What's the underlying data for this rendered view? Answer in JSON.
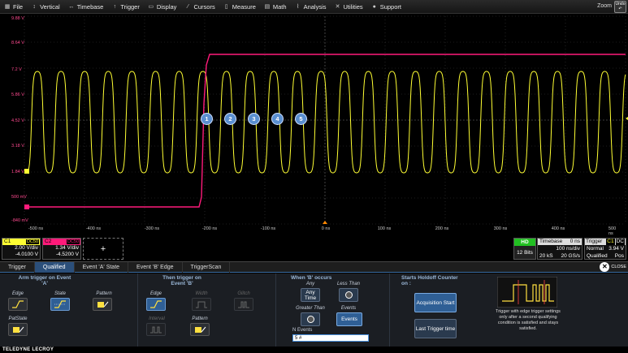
{
  "menubar": {
    "items": [
      {
        "label": "File",
        "icon": "file-icon"
      },
      {
        "label": "Vertical",
        "icon": "vertical-icon"
      },
      {
        "label": "Timebase",
        "icon": "timebase-icon"
      },
      {
        "label": "Trigger",
        "icon": "trigger-icon"
      },
      {
        "label": "Display",
        "icon": "display-icon"
      },
      {
        "label": "Cursors",
        "icon": "cursors-icon"
      },
      {
        "label": "Measure",
        "icon": "measure-icon"
      },
      {
        "label": "Math",
        "icon": "math-icon"
      },
      {
        "label": "Analysis",
        "icon": "analysis-icon"
      },
      {
        "label": "Utilities",
        "icon": "utilities-icon"
      },
      {
        "label": "Support",
        "icon": "support-icon"
      }
    ],
    "zoom_label": "Zoom",
    "undo_label": "Undo"
  },
  "grid": {
    "y_labels": [
      "9.88 V",
      "8.64 V",
      "7.2 V",
      "5.86 V",
      "4.52 V",
      "3.18 V",
      "1.84 V",
      "500 mV",
      "-840 mV"
    ],
    "x_labels": [
      "-500 ns",
      "-400 ns",
      "-300 ns",
      "-200 ns",
      "-100 ns",
      "0 ns",
      "100 ns",
      "200 ns",
      "300 ns",
      "400 ns",
      "500 ns"
    ],
    "markers": [
      "1",
      "2",
      "3",
      "4",
      "5"
    ],
    "ch1_color": "#ffff33",
    "ch2_color": "#ff1a7a"
  },
  "channels": {
    "c1": {
      "label": "C1",
      "coupling": "DC50",
      "vdiv": "2.00 V/div",
      "offset": "-4.0100 V"
    },
    "c2": {
      "label": "C2",
      "coupling": "DC50",
      "vdiv": "1.34 V/div",
      "offset": "-4.5200 V"
    },
    "add_label": "+"
  },
  "timebase": {
    "badge": "HD",
    "bits": "12 Bits",
    "label": "Timebase",
    "delay": "0 ns",
    "tdiv": "100 ns/div",
    "samples": "20 kS",
    "rate": "20 GS/s"
  },
  "trigger": {
    "label": "Trigger",
    "src": "C1",
    "coupling": "DC",
    "mode": "Normal",
    "level": "3.94 V",
    "type": "Qualified",
    "slope": "Pos"
  },
  "tabs": [
    {
      "label": "Trigger",
      "active": false
    },
    {
      "label": "Qualified",
      "active": true
    },
    {
      "label": "Event 'A' State",
      "active": false
    },
    {
      "label": "Event 'B' Edge",
      "active": false
    },
    {
      "label": "TriggerScan",
      "active": false
    }
  ],
  "close_label": "CLOSE",
  "arm": {
    "title": "Arm trigger on Event 'A'",
    "edge": "Edge",
    "state": "State",
    "pattern": "Pattern",
    "patstate": "PatState"
  },
  "then": {
    "title": "Then trigger on Event 'B'",
    "edge": "Edge",
    "width": "Width",
    "glitch": "Glitch",
    "interval": "Interval",
    "pattern": "Pattern"
  },
  "when": {
    "title": "When 'B' occurs",
    "any_label": "Any",
    "any_btn": "Any Time",
    "less_label": "Less Than",
    "greater_label": "Greater Than",
    "events_label": "Events",
    "events_btn": "Events",
    "nevents_label": "N Events",
    "nevents_value": "5 #"
  },
  "holdoff": {
    "title": "Starts Holdoff Counter on :",
    "acq": "Acquisition Start",
    "last": "Last Trigger time"
  },
  "help_text": "Trigger with edge trigger settings only after a second qualifying condition is satisfied and stays satisfied.",
  "footer": "TELEDYNE LECROY"
}
